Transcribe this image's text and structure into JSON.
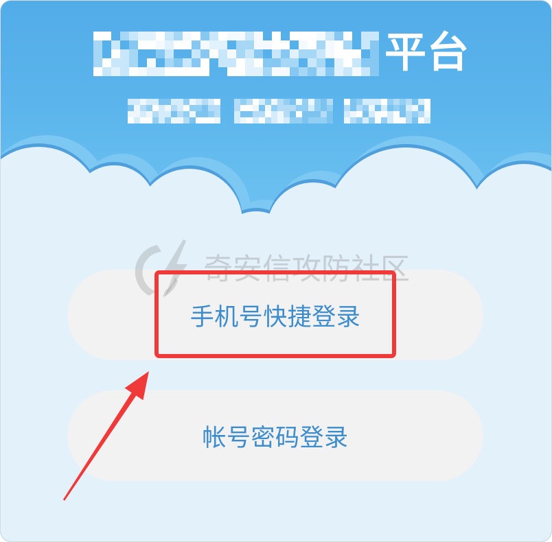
{
  "header": {
    "title_suffix": "平台"
  },
  "watermark": {
    "text": "奇安信攻防社区",
    "logo_icon": "qianxin-logo-icon"
  },
  "login_options": [
    {
      "label": "手机号快捷登录"
    },
    {
      "label": "帐号密码登录"
    }
  ],
  "annotation": {
    "box_icon": "highlight-box",
    "arrow_icon": "red-arrow-icon"
  },
  "colors": {
    "header_top": "#52ace8",
    "header_bottom": "#69c0f0",
    "cloud_front": "#e3f1fb",
    "button_background": "#f2f2f2",
    "button_text": "#3d8ccc",
    "annotation_red": "#f03a3a"
  }
}
